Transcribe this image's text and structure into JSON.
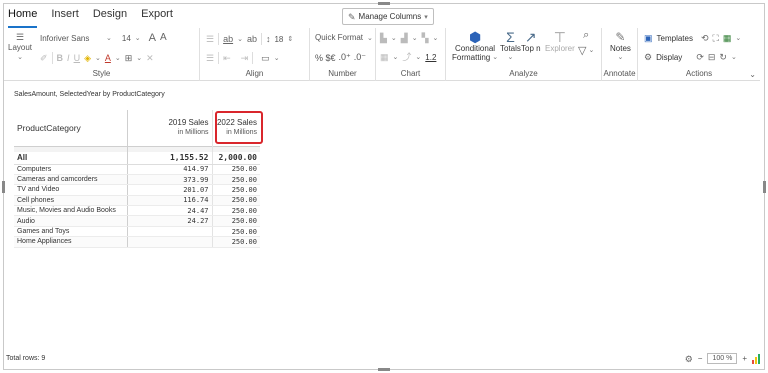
{
  "tabs": [
    {
      "label": "Home",
      "active": true
    },
    {
      "label": "Insert",
      "active": false
    },
    {
      "label": "Design",
      "active": false
    },
    {
      "label": "Export",
      "active": false
    }
  ],
  "manage_columns": {
    "label": "Manage Columns"
  },
  "style_group": {
    "layout_label": "Layout",
    "font_family": "Inforiver Sans",
    "font_size": "14",
    "label": "Style"
  },
  "align_group": {
    "spacing_value": "18",
    "label": "Align"
  },
  "number_group": {
    "quick_format": "Quick Format",
    "currency_symbols": "% $€",
    "decimals_inc": ".0⁺",
    "decimals_dec": ".0⁻",
    "label": "Number"
  },
  "chart_group": {
    "value_label": "1.2",
    "label": "Chart"
  },
  "analyze_group": {
    "conditional_label": "Conditional",
    "formatting_label": "Formatting",
    "totals_label": "Totals",
    "topn_label": "Top n",
    "explorer_label": "Explorer",
    "label": "Analyze"
  },
  "annotate_group": {
    "notes_label": "Notes",
    "label": "Annotate"
  },
  "actions_group": {
    "templates_label": "Templates",
    "display_label": "Display",
    "label": "Actions"
  },
  "report": {
    "caption": "SalesAmount, SelectedYear by ProductCategory",
    "header": {
      "category": "ProductCategory",
      "col1_title": "2019 Sales",
      "col1_sub": "in Millions",
      "col2_title": "2022 Sales",
      "col2_sub": "in Millions"
    },
    "total": {
      "label": "All",
      "v2019": "1,155.52",
      "v2022": "2,000.00"
    },
    "rows": [
      {
        "label": "Computers",
        "v2019": "414.97",
        "v2022": "250.00"
      },
      {
        "label": "Cameras and camcorders",
        "v2019": "373.99",
        "v2022": "250.00"
      },
      {
        "label": "TV and Video",
        "v2019": "201.07",
        "v2022": "250.00"
      },
      {
        "label": "Cell phones",
        "v2019": "116.74",
        "v2022": "250.00"
      },
      {
        "label": "Music, Movies and Audio Books",
        "v2019": "24.47",
        "v2022": "250.00"
      },
      {
        "label": "Audio",
        "v2019": "24.27",
        "v2022": "250.00"
      },
      {
        "label": "Games and Toys",
        "v2019": "",
        "v2022": "250.00"
      },
      {
        "label": "Home Appliances",
        "v2019": "",
        "v2022": "250.00"
      }
    ]
  },
  "status": {
    "total_rows": "Total rows: 9",
    "zoom": "100 %",
    "zoom_out": "−",
    "zoom_in": "+"
  },
  "colors": {
    "accent": "#1a73c9",
    "highlight": "#d9262c"
  }
}
